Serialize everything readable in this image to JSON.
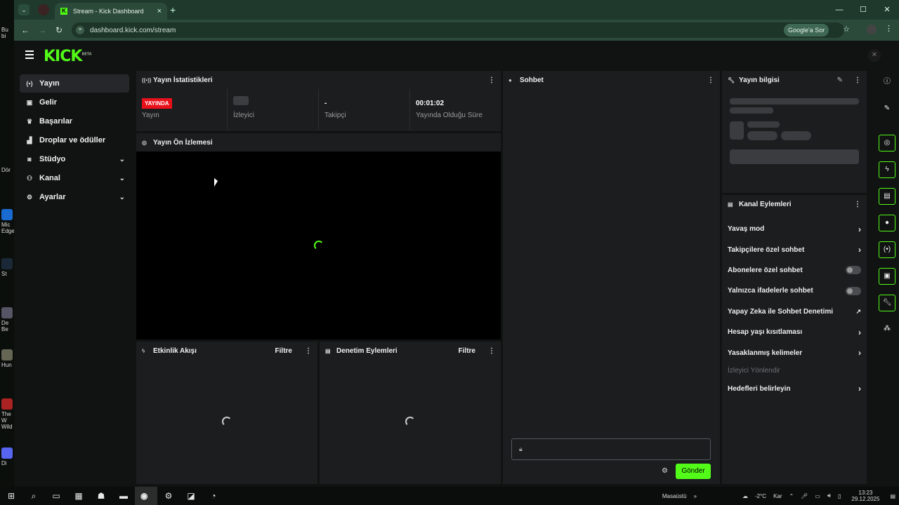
{
  "browser": {
    "tab_title": "Stream - Kick Dashboard",
    "url": "dashboard.kick.com/stream",
    "google_button": "Google'a Sor"
  },
  "desktop": {
    "icons": [
      "Bu bi",
      "Dör",
      "Mic Edge",
      "St",
      "De Be",
      "Hun",
      "The W Wild",
      "Di"
    ]
  },
  "header": {
    "logo": "KICK",
    "logo_badge": "BETA"
  },
  "sidebar": {
    "items": [
      {
        "label": "Yayın",
        "icon": "broadcast-icon"
      },
      {
        "label": "Gelir",
        "icon": "revenue-icon"
      },
      {
        "label": "Başarılar",
        "icon": "trophy-icon"
      },
      {
        "label": "Droplar ve ödüller",
        "icon": "drops-icon"
      },
      {
        "label": "Stüdyo",
        "icon": "studio-icon"
      },
      {
        "label": "Kanal",
        "icon": "channel-icon"
      },
      {
        "label": "Ayarlar",
        "icon": "settings-icon"
      }
    ]
  },
  "stats_panel": {
    "title": "Yayın İstatistikleri",
    "live_badge": "YAYINDA",
    "stats": [
      {
        "label": "Yayın",
        "value": ""
      },
      {
        "label": "İzleyici",
        "value": ""
      },
      {
        "label": "Takipçi",
        "value": "-"
      },
      {
        "label": "Yayında Olduğu Süre",
        "value": "00:01:02"
      }
    ]
  },
  "preview_panel": {
    "title": "Yayın Ön İzlemesi"
  },
  "activity_panel": {
    "title": "Etkinlik Akışı",
    "filter": "Filtre"
  },
  "moderation_panel": {
    "title": "Denetim Eylemleri",
    "filter": "Filtre"
  },
  "chat_panel": {
    "title": "Sohbet",
    "send": "Gönder"
  },
  "info_panel": {
    "title": "Yayın bilgisi"
  },
  "channel_actions": {
    "title": "Kanal Eylemleri",
    "items": [
      {
        "label": "Yavaş mod",
        "control": "chevron"
      },
      {
        "label": "Takipçilere özel sohbet",
        "control": "chevron"
      },
      {
        "label": "Abonelere özel sohbet",
        "control": "toggle"
      },
      {
        "label": "Yalnızca ifadelerle sohbet",
        "control": "toggle"
      },
      {
        "label": "Yapay Zeka ile Sohbet Denetimi",
        "control": "external"
      },
      {
        "label": "Hesap yaşı kısıtlaması",
        "control": "chevron"
      },
      {
        "label": "Yasaklanmış kelimeler",
        "control": "chevron"
      },
      {
        "label": "İzleyici Yönlendir",
        "control": "disabled"
      },
      {
        "label": "Hedefleri belirleyin",
        "control": "chevron"
      }
    ]
  },
  "taskbar": {
    "desktop_label": "Masaüstü",
    "weather": "-2°C",
    "weather_desc": "Kar",
    "time": "13:23",
    "date": "29.12.2025"
  },
  "colors": {
    "accent": "#53fc18",
    "live": "#e8101a",
    "panel": "#1b1d1f",
    "background": "#111312"
  }
}
